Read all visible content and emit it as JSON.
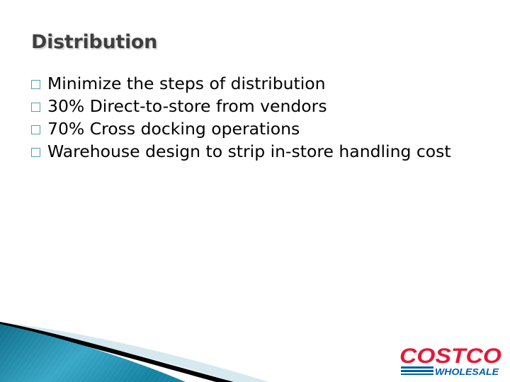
{
  "slide": {
    "title": "Distribution",
    "bullets": [
      {
        "text": "Minimize the steps of distribution"
      },
      {
        "text": "30% Direct-to-store from vendors"
      },
      {
        "text": "70% Cross docking operations"
      },
      {
        "text": "Warehouse design to strip in-store handling cost"
      }
    ],
    "bullet_icon": "square-outline-icon",
    "accent_color": "#4aa3b3"
  },
  "logo": {
    "brand": "COSTCO",
    "subtitle": "WHOLESALE",
    "brand_color": "#e31837",
    "subtitle_color": "#005daa"
  }
}
